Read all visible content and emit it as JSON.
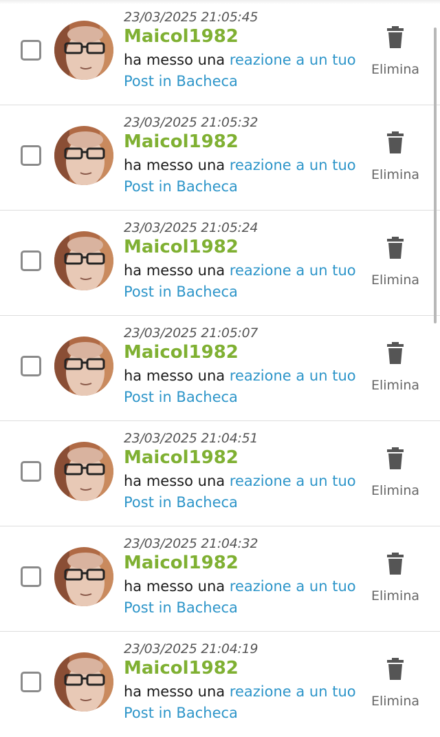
{
  "notifications": [
    {
      "timestamp": "23/03/2025 21:05:45",
      "user": "Maicol1982",
      "action_text": "ha messo una ",
      "link_text": "reazione a un tuo Post in Bacheca",
      "delete_label": "Elimina"
    },
    {
      "timestamp": "23/03/2025 21:05:32",
      "user": "Maicol1982",
      "action_text": "ha messo una ",
      "link_text": "reazione a un tuo Post in Bacheca",
      "delete_label": "Elimina"
    },
    {
      "timestamp": "23/03/2025 21:05:24",
      "user": "Maicol1982",
      "action_text": "ha messo una ",
      "link_text": "reazione a un tuo Post in Bacheca",
      "delete_label": "Elimina"
    },
    {
      "timestamp": "23/03/2025 21:05:07",
      "user": "Maicol1982",
      "action_text": "ha messo una ",
      "link_text": "reazione a un tuo Post in Bacheca",
      "delete_label": "Elimina"
    },
    {
      "timestamp": "23/03/2025 21:04:51",
      "user": "Maicol1982",
      "action_text": "ha messo una ",
      "link_text": "reazione a un tuo Post in Bacheca",
      "delete_label": "Elimina"
    },
    {
      "timestamp": "23/03/2025 21:04:32",
      "user": "Maicol1982",
      "action_text": "ha messo una ",
      "link_text": "reazione a un tuo Post in Bacheca",
      "delete_label": "Elimina"
    },
    {
      "timestamp": "23/03/2025 21:04:19",
      "user": "Maicol1982",
      "action_text": "ha messo una ",
      "link_text": "reazione a un tuo Post in Bacheca",
      "delete_label": "Elimina"
    }
  ],
  "colors": {
    "username": "#7fb032",
    "link": "#2d95c9",
    "text": "#1a1a1a",
    "muted": "#666666"
  },
  "icons": {
    "delete": "trash-icon",
    "checkbox": "checkbox-empty",
    "avatar": "user-photo"
  }
}
